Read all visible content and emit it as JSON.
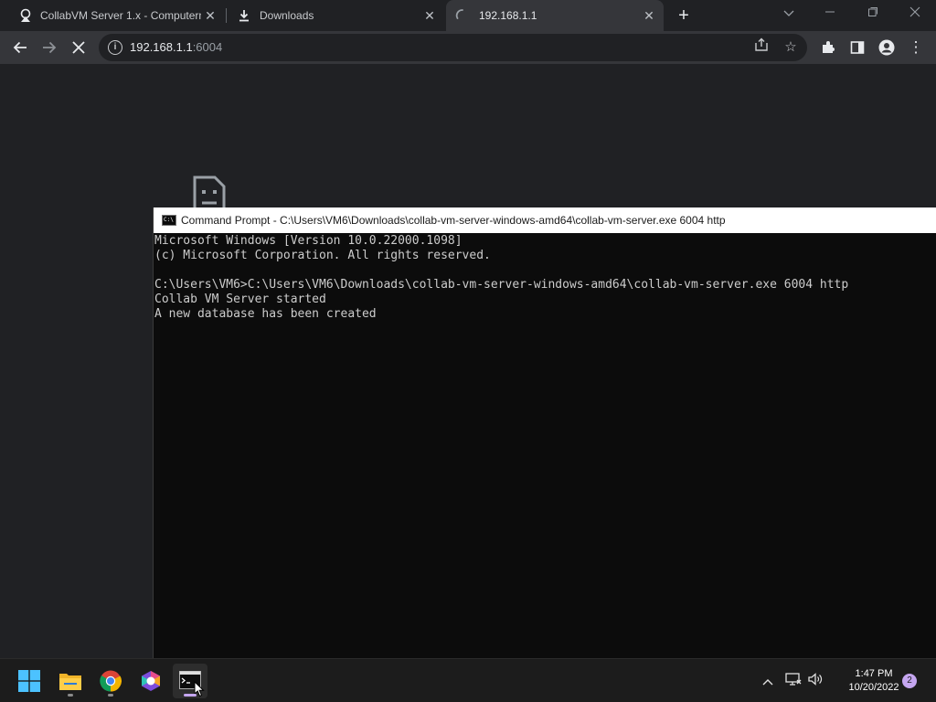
{
  "browser": {
    "tabs": [
      {
        "title": "CollabVM Server 1.x - Computern",
        "state": "inactive",
        "icon": "collabvm-icon"
      },
      {
        "title": "Downloads",
        "state": "inactive",
        "icon": "download-icon"
      },
      {
        "title": "192.168.1.1",
        "state": "active",
        "icon": "loading-spinner-icon"
      }
    ],
    "new_tab_label": "+",
    "url_host": "192.168.1.1",
    "url_port": ":6004"
  },
  "cmd": {
    "title": "Command Prompt - C:\\Users\\VM6\\Downloads\\collab-vm-server-windows-amd64\\collab-vm-server.exe  6004 http",
    "lines": [
      "Microsoft Windows [Version 10.0.22000.1098]",
      "(c) Microsoft Corporation. All rights reserved.",
      "",
      "C:\\Users\\VM6>C:\\Users\\VM6\\Downloads\\collab-vm-server-windows-amd64\\collab-vm-server.exe 6004 http",
      "Collab VM Server started",
      "A new database has been created"
    ]
  },
  "taskbar": {
    "apps": [
      {
        "name": "start-button",
        "icon": "windows-logo-icon"
      },
      {
        "name": "file-explorer",
        "icon": "folder-icon"
      },
      {
        "name": "chrome",
        "icon": "chrome-icon"
      },
      {
        "name": "app-hexagon",
        "icon": "hexagon-app-icon"
      },
      {
        "name": "command-prompt",
        "icon": "cmd-icon",
        "active": true
      }
    ],
    "time": "1:47 PM",
    "date": "10/20/2022",
    "notification_count": "2"
  },
  "colors": {
    "accent": "#c5a6f0",
    "browser_bg": "#202124",
    "toolbar_bg": "#35363a",
    "cmd_bg": "#0c0c0c",
    "cmd_text": "#cccccc"
  }
}
